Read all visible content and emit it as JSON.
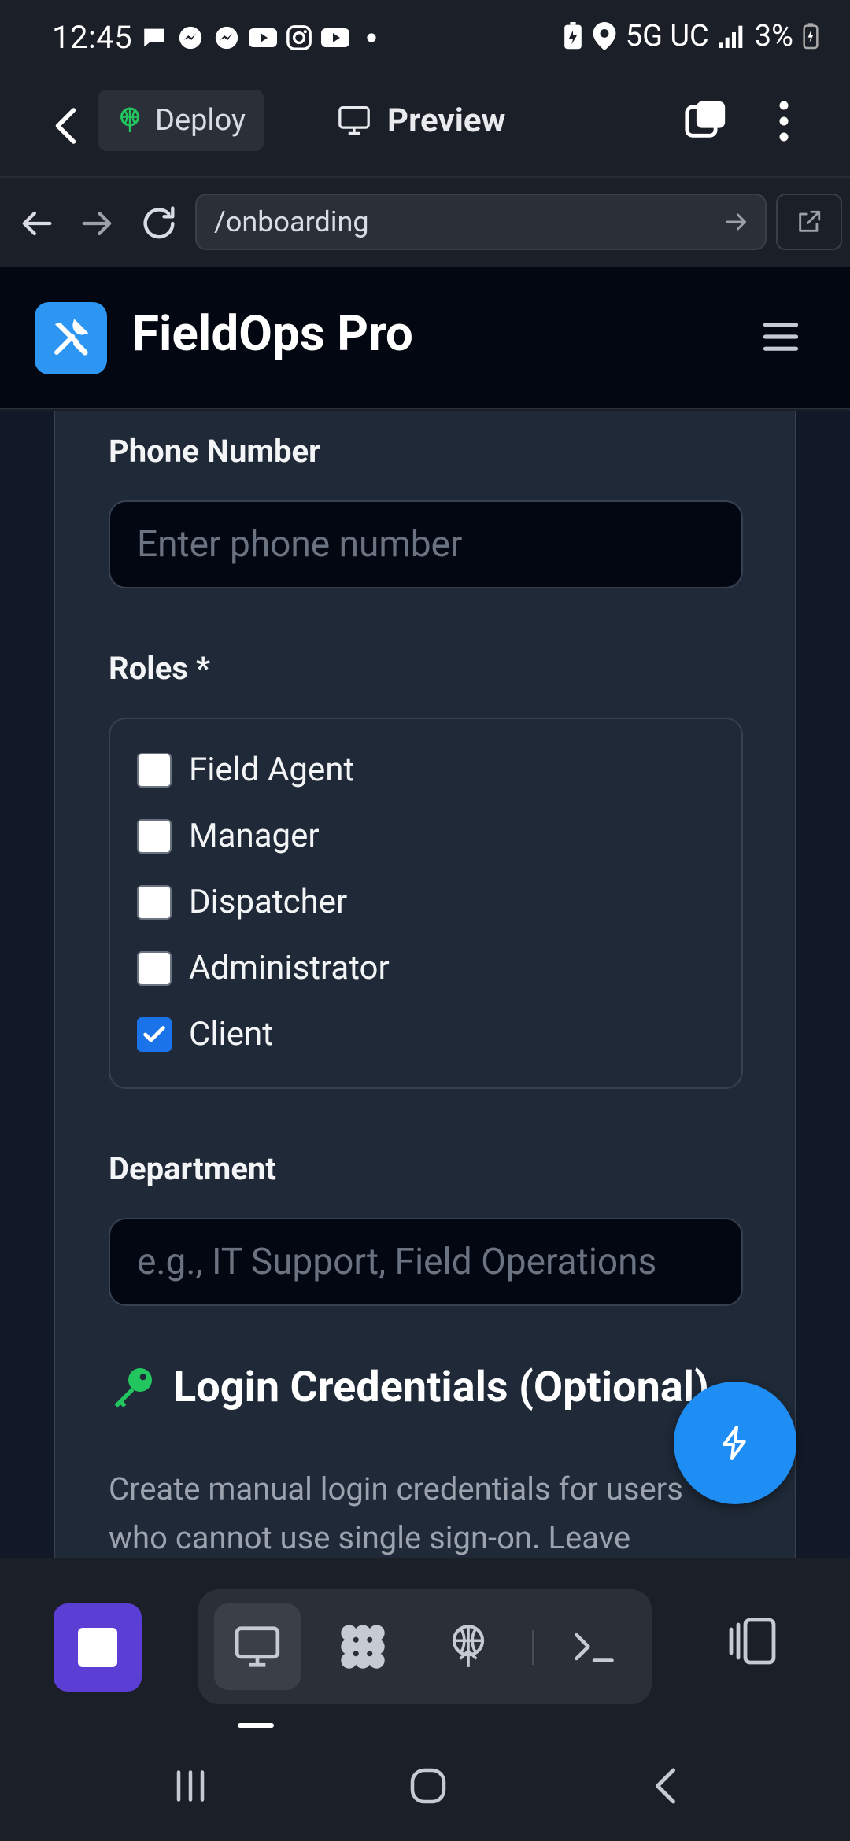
{
  "status": {
    "time": "12:45",
    "network": "5G UC",
    "battery": "3%"
  },
  "toolbar": {
    "deploy_label": "Deploy",
    "preview_label": "Preview"
  },
  "browser": {
    "url": "/onboarding"
  },
  "app": {
    "title": "FieldOps Pro"
  },
  "form": {
    "phone_label": "Phone Number",
    "phone_placeholder": "Enter phone number",
    "roles_label": "Roles *",
    "roles": [
      {
        "label": "Field Agent",
        "checked": false
      },
      {
        "label": "Manager",
        "checked": false
      },
      {
        "label": "Dispatcher",
        "checked": false
      },
      {
        "label": "Administrator",
        "checked": false
      },
      {
        "label": "Client",
        "checked": true
      }
    ],
    "department_label": "Department",
    "department_placeholder": "e.g., IT Support, Field Operations",
    "credentials_title": "Login Credentials (Optional)",
    "credentials_desc": "Create manual login credentials for users who cannot use single sign-on. Leave"
  },
  "colors": {
    "accent": "#2d96f3",
    "fab": "#1e8ef5",
    "stop": "#5b3fd4",
    "key_icon": "#22c55e",
    "checkbox_checked": "#1a73e8"
  },
  "icons": {
    "logo": "wrench-screwdriver-icon",
    "fab": "lightning-icon",
    "section": "key-icon"
  }
}
